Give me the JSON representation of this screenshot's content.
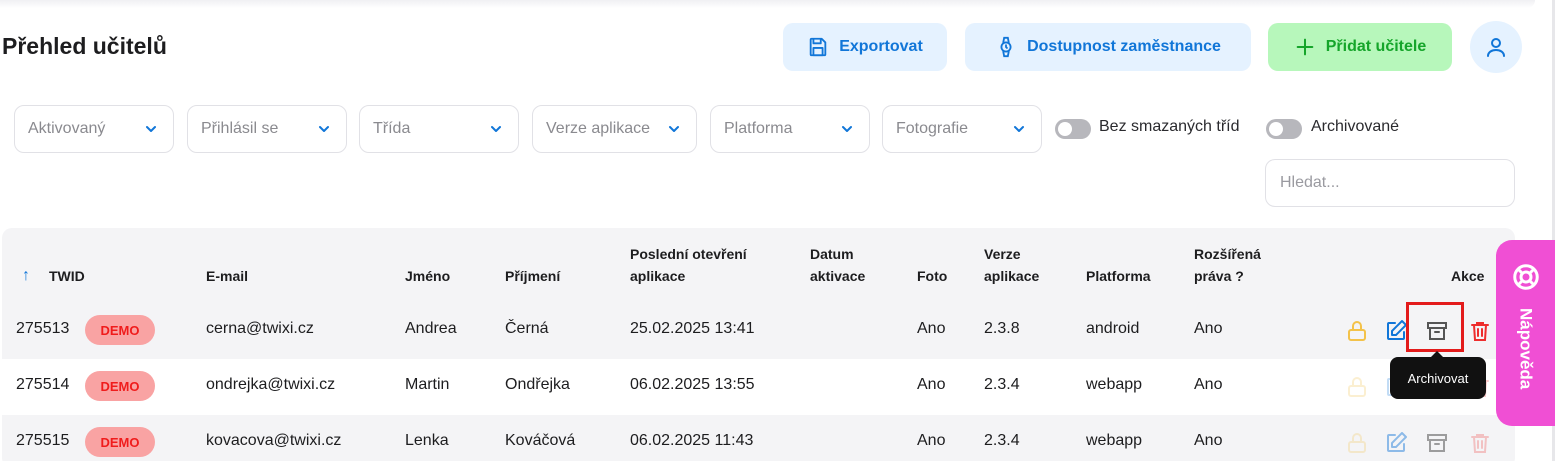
{
  "page": {
    "title": "Přehled učitelů"
  },
  "header_buttons": {
    "export": "Exportovat",
    "availability": "Dostupnost zaměstnance",
    "add_teacher": "Přidat učitele"
  },
  "filters": [
    "Aktivovaný",
    "Přihlásil se",
    "Třída",
    "Verze aplikace",
    "Platforma",
    "Fotografie"
  ],
  "toggles": {
    "no_deleted_classes": "Bez smazaných tříd",
    "archived": "Archivované"
  },
  "search": {
    "placeholder": "Hledat..."
  },
  "table": {
    "sort_arrow": "↑",
    "headers": {
      "twid": "TWID",
      "email": "E-mail",
      "first_name": "Jméno",
      "last_name": "Příjmení",
      "last_open_1": "Poslední otevření",
      "last_open_2": "aplikace",
      "activation_1": "Datum",
      "activation_2": "aktivace",
      "photo": "Foto",
      "version_1": "Verze",
      "version_2": "aplikace",
      "platform": "Platforma",
      "rights_1": "Rozšířená",
      "rights_2": "práva  ?",
      "actions": "Akce"
    },
    "rows": [
      {
        "twid": "275513",
        "badge": "DEMO",
        "email": "cerna@twixi.cz",
        "first_name": "Andrea",
        "last_name": "Černá",
        "last_open": "25.02.2025 13:41",
        "activation": "",
        "photo": "Ano",
        "version": "2.3.8",
        "platform": "android",
        "rights": "Ano"
      },
      {
        "twid": "275514",
        "badge": "DEMO",
        "email": "ondrejka@twixi.cz",
        "first_name": "Martin",
        "last_name": "Ondřejka",
        "last_open": "06.02.2025 13:55",
        "activation": "",
        "photo": "Ano",
        "version": "2.3.4",
        "platform": "webapp",
        "rights": "Ano"
      },
      {
        "twid": "275515",
        "badge": "DEMO",
        "email": "kovacova@twixi.cz",
        "first_name": "Lenka",
        "last_name": "Kováčová",
        "last_open": "06.02.2025 11:43",
        "activation": "",
        "photo": "Ano",
        "version": "2.3.4",
        "platform": "webapp",
        "rights": "Ano"
      }
    ]
  },
  "tooltip": {
    "text": "Archivovat"
  },
  "help": {
    "label": "Nápověda"
  },
  "colors": {
    "accent_blue": "#1176d8",
    "green": "#15a52a",
    "demo_red": "#f01c1c",
    "help_pink": "#f04fd4",
    "lock_yellow": "#f3c24a",
    "trash_red": "#ee2d2d"
  },
  "icons": {
    "export": "save-icon",
    "availability": "watch-icon",
    "add": "plus-icon",
    "user": "user-icon",
    "lock": "lock-icon",
    "edit": "edit-icon",
    "archive": "archive-icon",
    "trash": "trash-icon",
    "help": "lifebuoy-icon"
  }
}
